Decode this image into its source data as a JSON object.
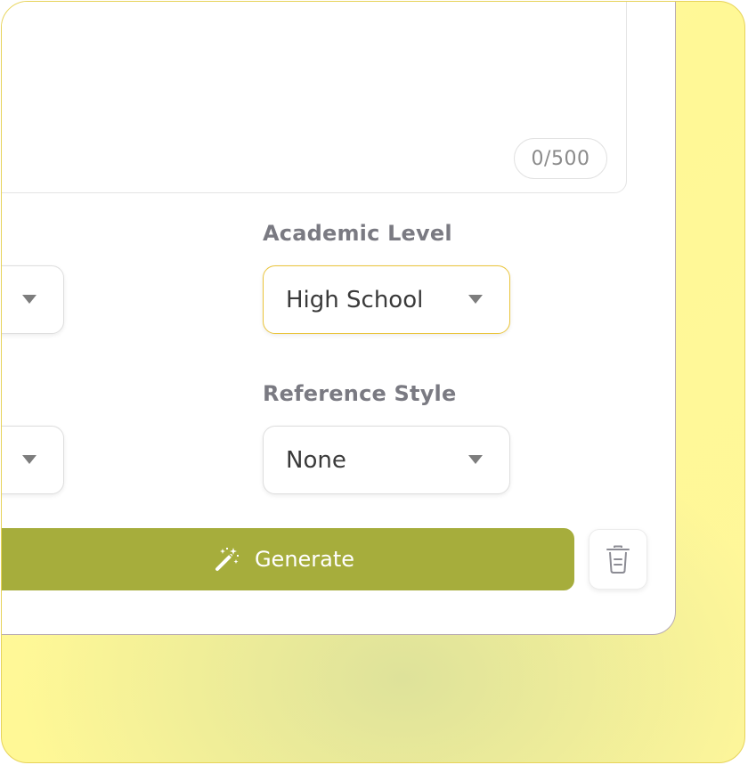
{
  "textarea": {
    "counter": "0/500"
  },
  "fields": {
    "academic_level": {
      "label": "Academic Level",
      "selected": "High School"
    },
    "reference_style": {
      "label": "Reference Style",
      "selected": "None"
    }
  },
  "actions": {
    "generate_label": "Generate",
    "generate_icon": "magic-wand-icon",
    "delete_icon": "trash-icon"
  },
  "colors": {
    "accent": "#a6ad3c",
    "active_border": "#eac43a"
  }
}
